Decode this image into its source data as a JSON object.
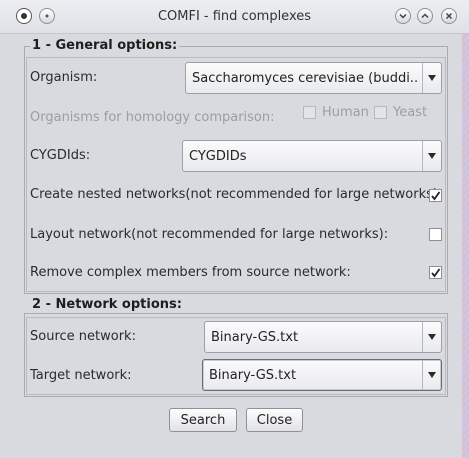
{
  "window": {
    "title": "COMFI - find complexes"
  },
  "general": {
    "section_title": "1 - General options:",
    "organism_label": "Organism:",
    "organism_value": "Saccharomyces cerevisiae (buddi...",
    "homology_label": "Organisms for homology comparison:",
    "homology_options": [
      {
        "label": "Human",
        "checked": false
      },
      {
        "label": "Yeast",
        "checked": false
      }
    ],
    "cygdids_label": "CYGDIds:",
    "cygdids_value": "CYGDIDs",
    "nested_label": "Create nested networks(not recommended for large networks):",
    "nested_checked": true,
    "layout_label": "Layout network(not recommended for large networks):",
    "layout_checked": false,
    "remove_label": "Remove complex members from source network:",
    "remove_checked": true
  },
  "network": {
    "section_title": "2 - Network options:",
    "source_label": "Source network:",
    "source_value": "Binary-GS.txt",
    "target_label": "Target network:",
    "target_value": "Binary-GS.txt"
  },
  "buttons": {
    "search": "Search",
    "close": "Close"
  },
  "icons": {
    "app": "app-icon",
    "sticky": "sticky-icon",
    "minimize": "chevron-down-icon",
    "maximize": "chevron-up-icon",
    "close": "close-icon",
    "combo_arrow": "triangle-down-icon",
    "check": "checkmark-icon"
  }
}
